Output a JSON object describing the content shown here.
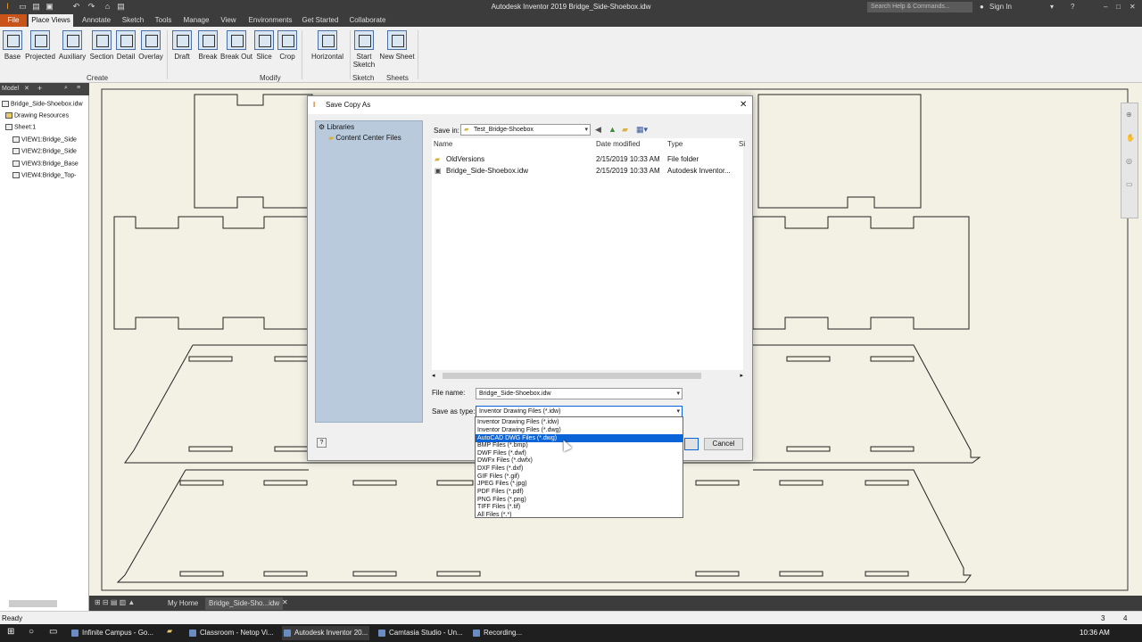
{
  "window": {
    "title": "Autodesk Inventor 2019  Bridge_Side-Shoebox.idw",
    "search_placeholder": "Search Help & Commands...",
    "sign_in": "Sign In"
  },
  "menu_tabs": [
    "File",
    "Place Views",
    "Annotate",
    "Sketch",
    "Tools",
    "Manage",
    "View",
    "Environments",
    "Get Started",
    "Collaborate"
  ],
  "ribbon": {
    "buttons": [
      "Base",
      "Projected",
      "Auxiliary",
      "Section",
      "Detail",
      "Overlay",
      "Draft",
      "Break",
      "Break Out",
      "Slice",
      "Crop",
      "Horizontal",
      "Start Sketch",
      "New Sheet"
    ],
    "groups": [
      "Create",
      "Modify",
      "Sketch",
      "Sheets"
    ]
  },
  "browser": {
    "tab": "Model",
    "items": [
      "Bridge_Side-Shoebox.idw",
      "Drawing Resources",
      "Sheet:1",
      "VIEW1:Bridge_Side",
      "VIEW2:Bridge_Side",
      "VIEW3:Bridge_Base",
      "VIEW4:Bridge_Top-"
    ]
  },
  "dialog": {
    "title": "Save Copy As",
    "places": [
      "Libraries",
      "Content Center Files"
    ],
    "save_in_label": "Save in:",
    "save_in_value": "Test_Bridge-Shoebox",
    "columns": [
      "Name",
      "Date modified",
      "Type",
      "Si"
    ],
    "files": [
      {
        "name": "OldVersions",
        "date": "2/15/2019 10:33 AM",
        "type": "File folder"
      },
      {
        "name": "Bridge_Side-Shoebox.idw",
        "date": "2/15/2019 10:33 AM",
        "type": "Autodesk Inventor..."
      }
    ],
    "file_name_label": "File name:",
    "file_name_value": "Bridge_Side-Shoebox.idw",
    "save_as_type_label": "Save as type:",
    "save_as_type_value": "Inventor Drawing Files (*.idw)",
    "type_options": [
      "Inventor Drawing Files (*.idw)",
      "Inventor Drawing Files (*.dwg)",
      "AutoCAD DWG Files (*.dwg)",
      "BMP Files (*.bmp)",
      "DWF Files (*.dwf)",
      "DWFx Files (*.dwfx)",
      "DXF Files (*.dxf)",
      "GIF Files (*.gif)",
      "JPEG Files (*.jpg)",
      "PDF Files (*.pdf)",
      "PNG Files (*.png)",
      "TIFF Files (*.tif)",
      "All Files (*.*)"
    ],
    "selected_option_index": 2,
    "cancel_label": "Cancel"
  },
  "doc_tabs": [
    "My Home",
    "Bridge_Side-Sho...idw"
  ],
  "status": {
    "text": "Ready",
    "count_a": "3",
    "count_b": "4"
  },
  "taskbar": {
    "items": [
      "Infinite Campus - Go...",
      "Classroom - Netop Vi...",
      "Autodesk Inventor 20...",
      "Camtasia Studio - Un...",
      "Recording..."
    ],
    "clock": "10:36 AM"
  },
  "colors": {
    "accent": "#0a64d8",
    "chrome": "#3c3c3c",
    "canvas": "#f3f1e4",
    "places": "#b9cadc"
  }
}
